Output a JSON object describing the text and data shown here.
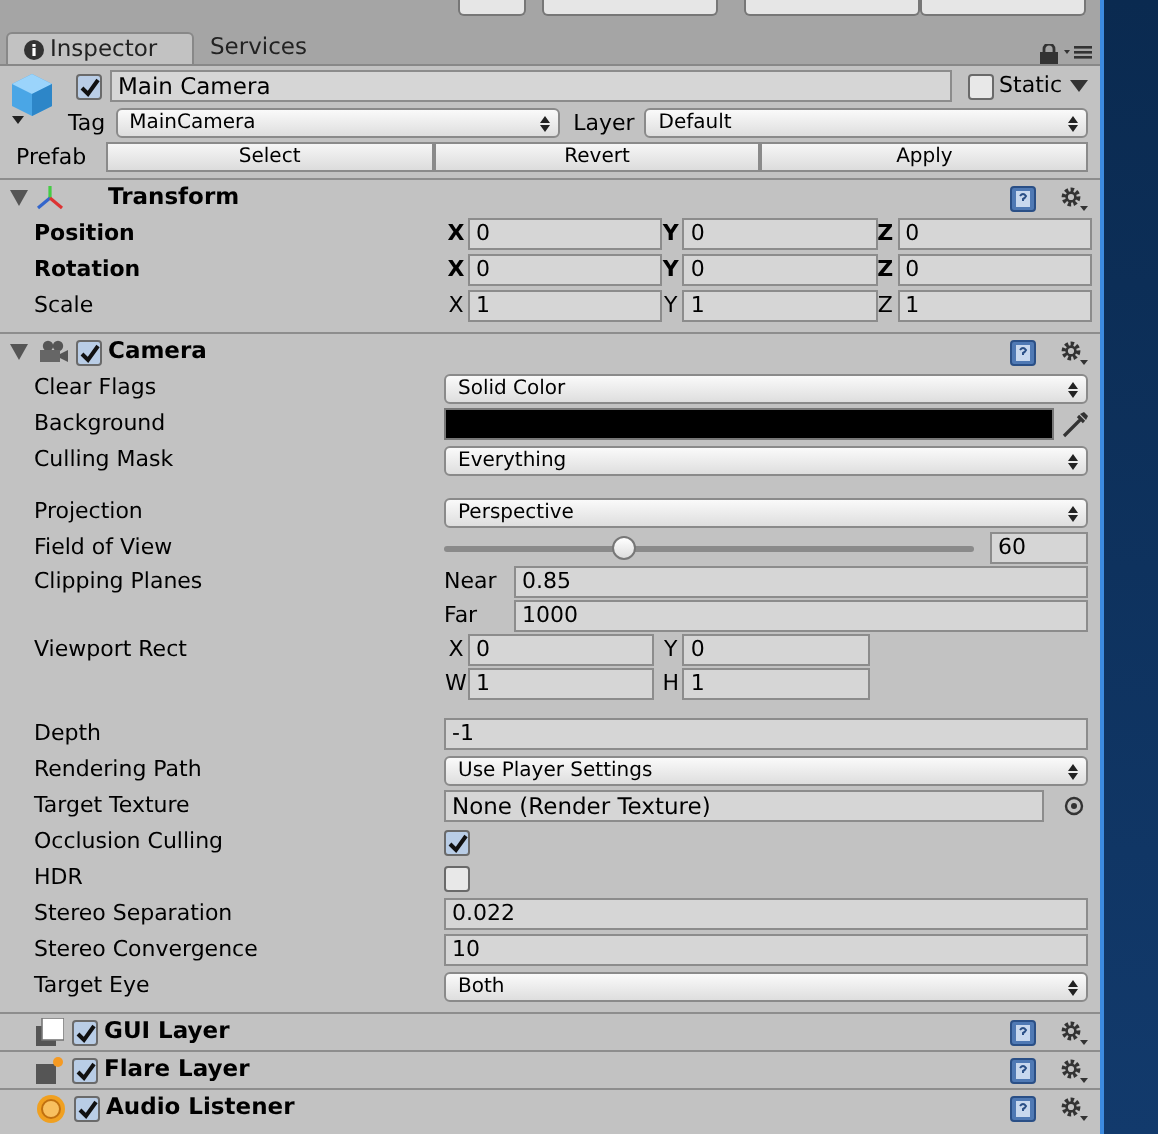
{
  "toolbar": {
    "buttons": [
      {
        "kind": "icon"
      },
      {
        "kind": "menu"
      },
      {
        "kind": "menu"
      },
      {
        "kind": "menu"
      }
    ]
  },
  "tabs": [
    {
      "label": "Inspector",
      "selected": true
    },
    {
      "label": "Services",
      "selected": false
    }
  ],
  "object": {
    "name": "Main Camera",
    "active": true,
    "static": {
      "label": "Static",
      "checked": false
    },
    "tag": {
      "label": "Tag",
      "value": "MainCamera"
    },
    "layer": {
      "label": "Layer",
      "value": "Default"
    },
    "prefab": {
      "label": "Prefab",
      "buttons": [
        "Select",
        "Revert",
        "Apply"
      ]
    }
  },
  "components": [
    {
      "title": "Transform",
      "kind": "transform",
      "expanded": true,
      "properties": [
        {
          "kind": "vector",
          "label": "Position",
          "modified": true,
          "fields": [
            {
              "axis": "X",
              "value": "0"
            },
            {
              "axis": "Y",
              "value": "0"
            },
            {
              "axis": "Z",
              "value": "0"
            }
          ]
        },
        {
          "kind": "vector",
          "label": "Rotation",
          "modified": true,
          "fields": [
            {
              "axis": "X",
              "value": "0"
            },
            {
              "axis": "Y",
              "value": "0"
            },
            {
              "axis": "Z",
              "value": "0"
            }
          ]
        },
        {
          "kind": "vector",
          "label": "Scale",
          "modified": false,
          "fields": [
            {
              "axis": "X",
              "value": "1"
            },
            {
              "axis": "Y",
              "value": "1"
            },
            {
              "axis": "Z",
              "value": "1"
            }
          ]
        }
      ]
    },
    {
      "title": "Camera",
      "kind": "camera",
      "enabled": true,
      "expanded": true,
      "properties": [
        {
          "kind": "dropdown",
          "label": "Clear Flags",
          "value": "Solid Color"
        },
        {
          "kind": "color",
          "label": "Background",
          "color": "#000000"
        },
        {
          "kind": "dropdown",
          "label": "Culling Mask",
          "value": "Everything"
        },
        {
          "kind": "dropdown",
          "label": "Projection",
          "value": "Perspective",
          "gap_before": true
        },
        {
          "kind": "slider",
          "label": "Field of View",
          "level": 0.34,
          "value": "60"
        },
        {
          "kind": "labeled_fields",
          "label": "Clipping Planes",
          "fields": [
            {
              "axis": "Near",
              "value": "0.85"
            },
            {
              "axis": "Far",
              "value": "1000"
            }
          ]
        },
        {
          "kind": "rect",
          "label": "Viewport Rect",
          "fields": [
            {
              "axis": "X",
              "value": "0"
            },
            {
              "axis": "Y",
              "value": "0"
            },
            {
              "axis": "W",
              "value": "1"
            },
            {
              "axis": "H",
              "value": "1"
            }
          ]
        },
        {
          "kind": "field",
          "label": "Depth",
          "value": "-1",
          "gap_before": true
        },
        {
          "kind": "dropdown",
          "label": "Rendering Path",
          "value": "Use Player Settings"
        },
        {
          "kind": "object",
          "label": "Target Texture",
          "value": "None (Render Texture)"
        },
        {
          "kind": "checkbox",
          "label": "Occlusion Culling",
          "checked": true
        },
        {
          "kind": "checkbox",
          "label": "HDR",
          "checked": false
        },
        {
          "kind": "field",
          "label": "Stereo Separation",
          "value": "0.022"
        },
        {
          "kind": "field",
          "label": "Stereo Convergence",
          "value": "10"
        },
        {
          "kind": "dropdown",
          "label": "Target Eye",
          "value": "Both"
        }
      ]
    },
    {
      "title": "GUI Layer",
      "kind": "gui_layer",
      "enabled": true,
      "expanded": false
    },
    {
      "title": "Flare Layer",
      "kind": "flare_layer",
      "enabled": true,
      "expanded": false
    },
    {
      "title": "Audio Listener",
      "kind": "audio_listener",
      "enabled": true,
      "expanded": false
    }
  ]
}
